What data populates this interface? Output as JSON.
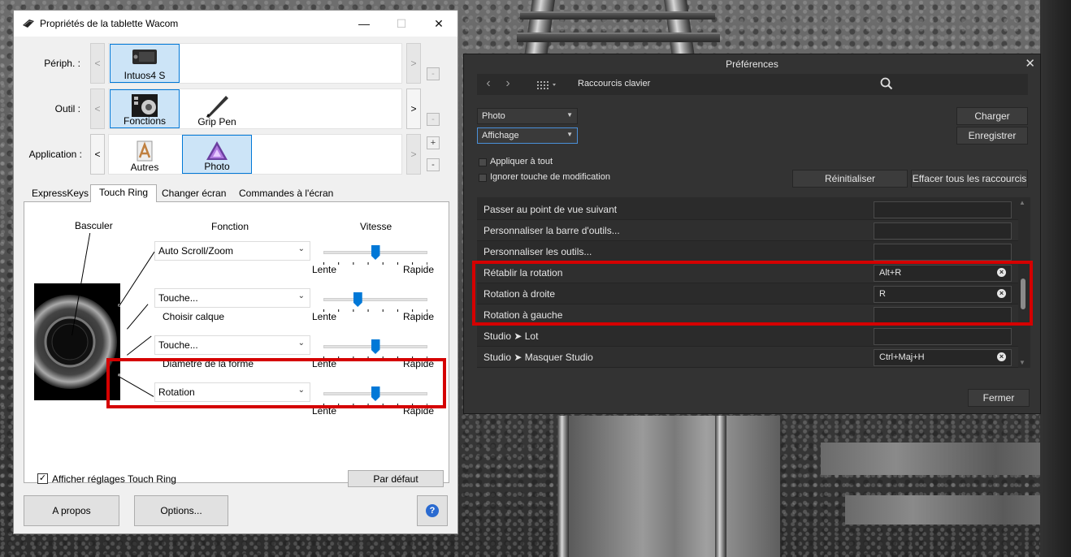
{
  "wacom": {
    "title": "Propriétés de la tablette Wacom",
    "window_controls": {
      "minimize": "—",
      "maximize": "☐",
      "close": "✕"
    },
    "labels": {
      "device": "Périph. :",
      "tool": "Outil :",
      "application": "Application :"
    },
    "device_tiles": [
      {
        "label": "Intuos4 S",
        "selected": true
      }
    ],
    "tool_tiles": [
      {
        "label": "Fonctions",
        "selected": true
      },
      {
        "label": "Grip Pen",
        "selected": false
      }
    ],
    "app_tiles": [
      {
        "label": "Autres",
        "selected": false
      },
      {
        "label": "Photo",
        "selected": true
      }
    ],
    "scroll": {
      "left": "<",
      "right": ">"
    },
    "side_buttons": {
      "minus": "-",
      "plus": "+"
    },
    "tabs": [
      "ExpressKeys",
      "Touch Ring",
      "Changer écran",
      "Commandes à l'écran"
    ],
    "active_tab": "Touch Ring",
    "panel": {
      "col_toggle": "Basculer",
      "col_function": "Fonction",
      "col_speed": "Vitesse",
      "rows": [
        {
          "function": "Auto Scroll/Zoom",
          "sub": "",
          "speed_level": 0.5
        },
        {
          "function": "Touche...",
          "sub": "Choisir calque",
          "speed_level": 0.33
        },
        {
          "function": "Touche...",
          "sub": "Diamètre de la forme",
          "speed_level": 0.5
        },
        {
          "function": "Rotation",
          "sub": "",
          "speed_level": 0.5
        }
      ],
      "slow": "Lente",
      "fast": "Rapide",
      "show_settings_label": "Afficher réglages Touch Ring",
      "show_settings_checked": true,
      "default_button": "Par défaut"
    },
    "bottom": {
      "about": "A propos",
      "options": "Options...",
      "help": "?"
    }
  },
  "prefs": {
    "title": "Préférences",
    "close": "✕",
    "section": "Raccourcis clavier",
    "dropdown_1": "Photo",
    "dropdown_2": "Affichage",
    "load_button": "Charger",
    "save_button": "Enregistrer",
    "apply_all": "Appliquer à tout",
    "ignore_modifier": "Ignorer touche de modification",
    "reset_button": "Réinitialiser",
    "clear_all_button": "Effacer tous les raccourcis",
    "ok_button": "Fermer",
    "shortcuts": [
      {
        "name": "Passer au point de vue suivant",
        "key": "",
        "clear": false
      },
      {
        "name": "Personnaliser la barre d'outils...",
        "key": "",
        "clear": false
      },
      {
        "name": "Personnaliser les outils...",
        "key": "",
        "clear": false
      },
      {
        "name": "Rétablir la rotation",
        "key": "Alt+R",
        "clear": true
      },
      {
        "name": "Rotation à droite",
        "key": "R",
        "clear": true
      },
      {
        "name": "Rotation à gauche",
        "key": "",
        "clear": false
      },
      {
        "name": "Studio ➤ Lot",
        "key": "",
        "clear": false
      },
      {
        "name": "Studio ➤ Masquer Studio",
        "key": "Ctrl+Maj+H",
        "clear": true
      }
    ]
  },
  "colors": {
    "highlight": "#d50000",
    "accent": "#0078d7",
    "dark_bg": "#333333"
  }
}
